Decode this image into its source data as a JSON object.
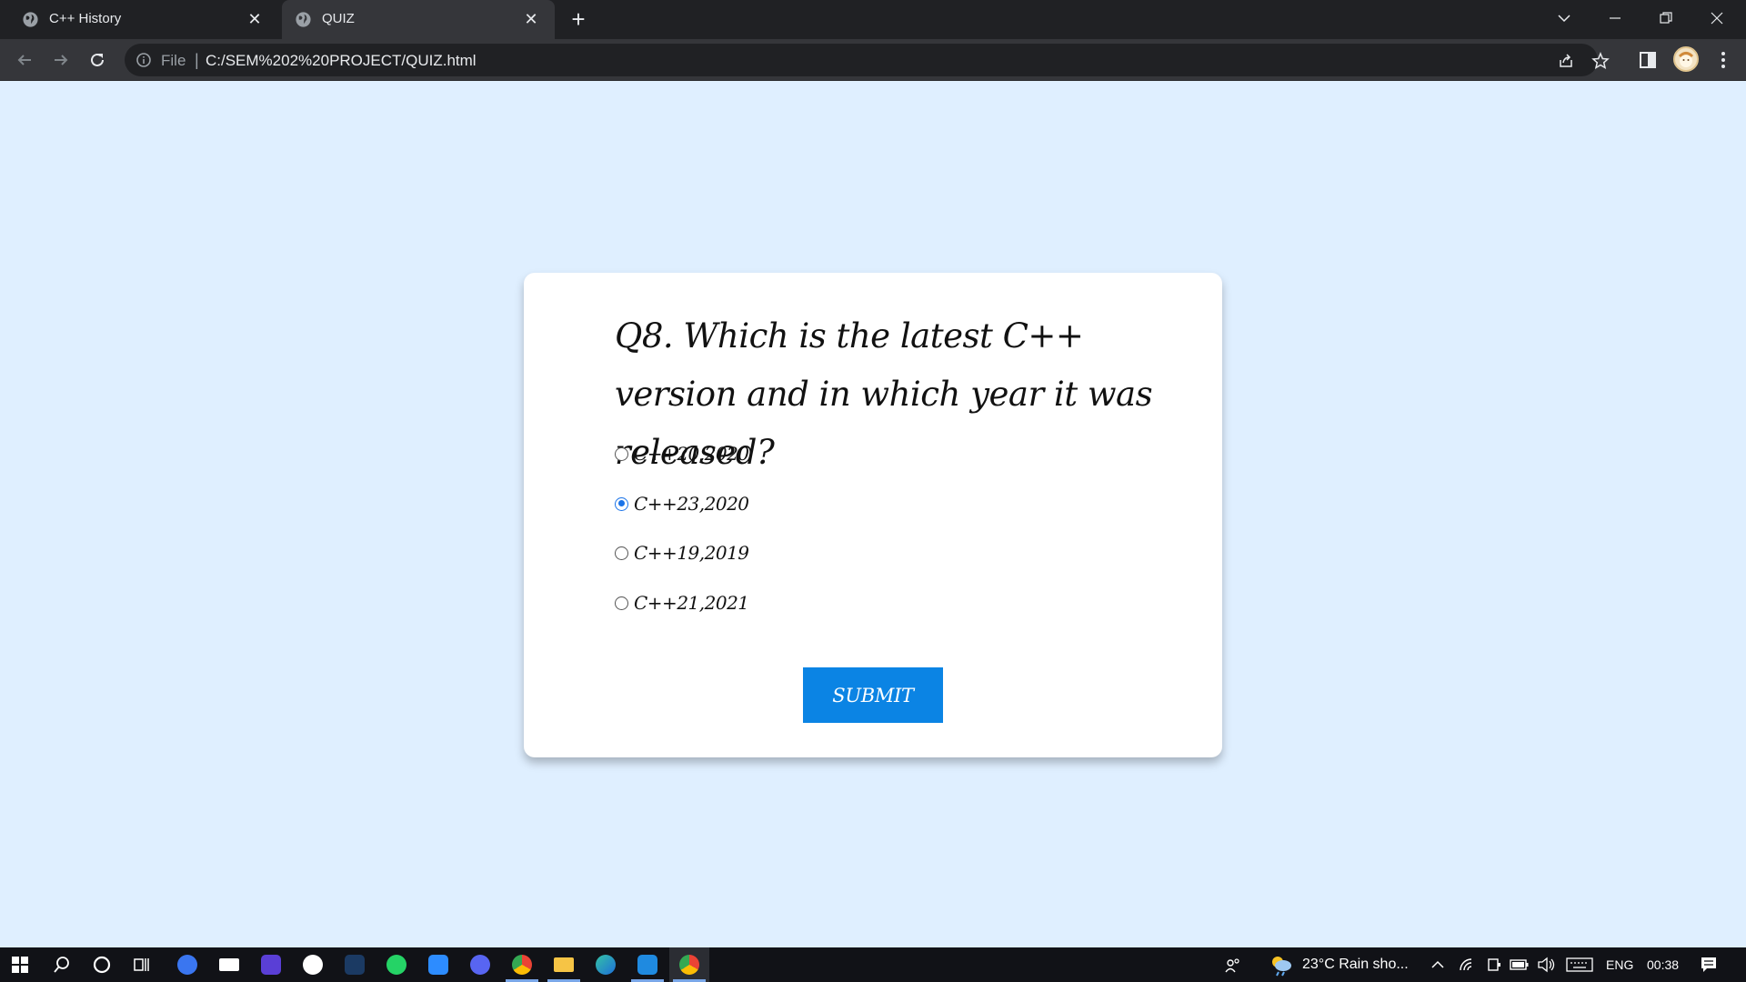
{
  "browser": {
    "tabs": [
      {
        "title": "C++ History",
        "active": false
      },
      {
        "title": "QUIZ",
        "active": true
      }
    ],
    "address": {
      "scheme_label": "File",
      "url": "C:/SEM%202%20PROJECT/QUIZ.html"
    }
  },
  "quiz": {
    "question": "Q8. Which is the latest C++ version and in which year it was released?",
    "options": [
      {
        "label": "C++20,2020",
        "selected": false
      },
      {
        "label": "C++23,2020",
        "selected": true
      },
      {
        "label": "C++19,2019",
        "selected": false
      },
      {
        "label": "C++21,2021",
        "selected": false
      }
    ],
    "submit_label": "SUBMIT"
  },
  "taskbar": {
    "weather": "23°C  Rain sho...",
    "language": "ENG",
    "time": "00:38"
  },
  "colors": {
    "page_background": "#dfefff",
    "accent": "#0b84e4",
    "radio_selected": "#1a73e8"
  }
}
